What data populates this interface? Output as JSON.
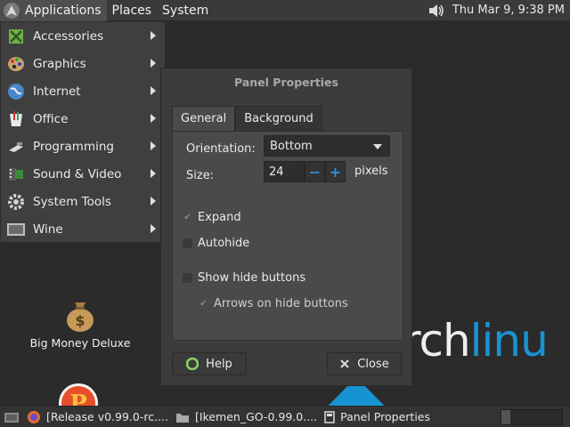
{
  "top_panel": {
    "menus": [
      "Applications",
      "Places",
      "System"
    ],
    "clock": "Thu Mar  9,  9:38 PM"
  },
  "apps_menu": {
    "items": [
      {
        "label": "Accessories",
        "icon": "accessories-icon"
      },
      {
        "label": "Graphics",
        "icon": "graphics-icon"
      },
      {
        "label": "Internet",
        "icon": "internet-icon"
      },
      {
        "label": "Office",
        "icon": "office-icon"
      },
      {
        "label": "Programming",
        "icon": "programming-icon"
      },
      {
        "label": "Sound & Video",
        "icon": "sound-video-icon"
      },
      {
        "label": "System Tools",
        "icon": "system-tools-icon"
      },
      {
        "label": "Wine",
        "icon": "wine-icon"
      }
    ]
  },
  "desktop": {
    "icons": [
      {
        "label": "Big Money Deluxe",
        "icon": "money-bag-icon"
      },
      {
        "label": "",
        "icon": "game-p-icon"
      }
    ],
    "wallpaper_text": {
      "part1": "rch",
      "part2": "linu"
    }
  },
  "dialog": {
    "title": "Panel Properties",
    "tabs": [
      "General",
      "Background"
    ],
    "active_tab": "General",
    "orientation_label": "Orientation:",
    "orientation_value": "Bottom",
    "size_label": "Size:",
    "size_value": "24",
    "size_unit": "pixels",
    "expand_label": "Expand",
    "expand_checked": true,
    "autohide_label": "Autohide",
    "autohide_checked": false,
    "show_hide_label": "Show hide buttons",
    "show_hide_checked": false,
    "arrows_label": "Arrows on hide buttons",
    "arrows_checked": true,
    "help_label": "Help",
    "close_label": "Close"
  },
  "taskbar": {
    "tasks": [
      {
        "label": "[Release v0.99.0-rc....",
        "icon": "firefox-icon"
      },
      {
        "label": "[Ikemen_GO-0.99.0....",
        "icon": "folder-icon"
      },
      {
        "label": "Panel Properties",
        "icon": "window-icon"
      }
    ]
  },
  "colors": {
    "accent": "#2f8fd8",
    "arch_blue": "#1793d1"
  }
}
